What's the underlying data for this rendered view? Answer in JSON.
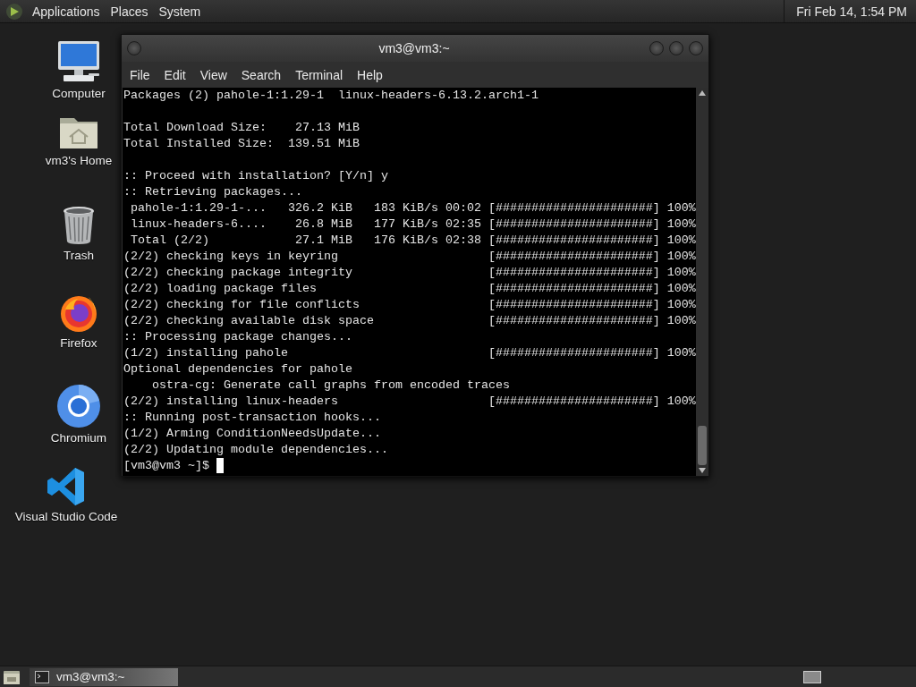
{
  "top_panel": {
    "menus": [
      "Applications",
      "Places",
      "System"
    ],
    "clock": "Fri Feb 14, 1:54 PM"
  },
  "desktop_icons": [
    {
      "kind": "computer",
      "label": "Computer"
    },
    {
      "kind": "home",
      "label": "vm3's Home"
    },
    {
      "kind": "trash",
      "label": "Trash"
    },
    {
      "kind": "firefox",
      "label": "Firefox"
    },
    {
      "kind": "chromium",
      "label": "Chromium"
    },
    {
      "kind": "vscode",
      "label": "Visual Studio Code"
    }
  ],
  "window": {
    "title": "vm3@vm3:~",
    "menu": [
      "File",
      "Edit",
      "View",
      "Search",
      "Terminal",
      "Help"
    ],
    "lines": [
      {
        "kind": "text",
        "text": "Packages (2) pahole-1:1.29-1  linux-headers-6.13.2.arch1-1"
      },
      {
        "kind": "blank"
      },
      {
        "kind": "text",
        "text": "Total Download Size:    27.13 MiB"
      },
      {
        "kind": "text",
        "text": "Total Installed Size:  139.51 MiB"
      },
      {
        "kind": "blank"
      },
      {
        "kind": "text",
        "text": ":: Proceed with installation? [Y/n] y"
      },
      {
        "kind": "text",
        "text": ":: Retrieving packages..."
      },
      {
        "kind": "progress",
        "text": " pahole-1:1.29-1-...   326.2 KiB   183 KiB/s 00:02",
        "bar": "[######################]",
        "percent": "100%"
      },
      {
        "kind": "progress",
        "text": " linux-headers-6....    26.8 MiB   177 KiB/s 02:35",
        "bar": "[######################]",
        "percent": "100%"
      },
      {
        "kind": "progress",
        "text": " Total (2/2)            27.1 MiB   176 KiB/s 02:38",
        "bar": "[######################]",
        "percent": "100%"
      },
      {
        "kind": "progress",
        "text": "(2/2) checking keys in keyring",
        "bar": "[######################]",
        "percent": "100%"
      },
      {
        "kind": "progress",
        "text": "(2/2) checking package integrity",
        "bar": "[######################]",
        "percent": "100%"
      },
      {
        "kind": "progress",
        "text": "(2/2) loading package files",
        "bar": "[######################]",
        "percent": "100%"
      },
      {
        "kind": "progress",
        "text": "(2/2) checking for file conflicts",
        "bar": "[######################]",
        "percent": "100%"
      },
      {
        "kind": "progress",
        "text": "(2/2) checking available disk space",
        "bar": "[######################]",
        "percent": "100%"
      },
      {
        "kind": "text",
        "text": ":: Processing package changes..."
      },
      {
        "kind": "progress",
        "text": "(1/2) installing pahole",
        "bar": "[######################]",
        "percent": "100%"
      },
      {
        "kind": "text",
        "text": "Optional dependencies for pahole"
      },
      {
        "kind": "text",
        "text": "    ostra-cg: Generate call graphs from encoded traces"
      },
      {
        "kind": "progress",
        "text": "(2/2) installing linux-headers",
        "bar": "[######################]",
        "percent": "100%"
      },
      {
        "kind": "text",
        "text": ":: Running post-transaction hooks..."
      },
      {
        "kind": "text",
        "text": "(1/2) Arming ConditionNeedsUpdate..."
      },
      {
        "kind": "text",
        "text": "(2/2) Updating module dependencies..."
      },
      {
        "kind": "prompt",
        "text": "[vm3@vm3 ~]$"
      }
    ]
  },
  "taskbar": {
    "tasks": [
      {
        "label": "vm3@vm3:~",
        "selected": true
      }
    ]
  }
}
